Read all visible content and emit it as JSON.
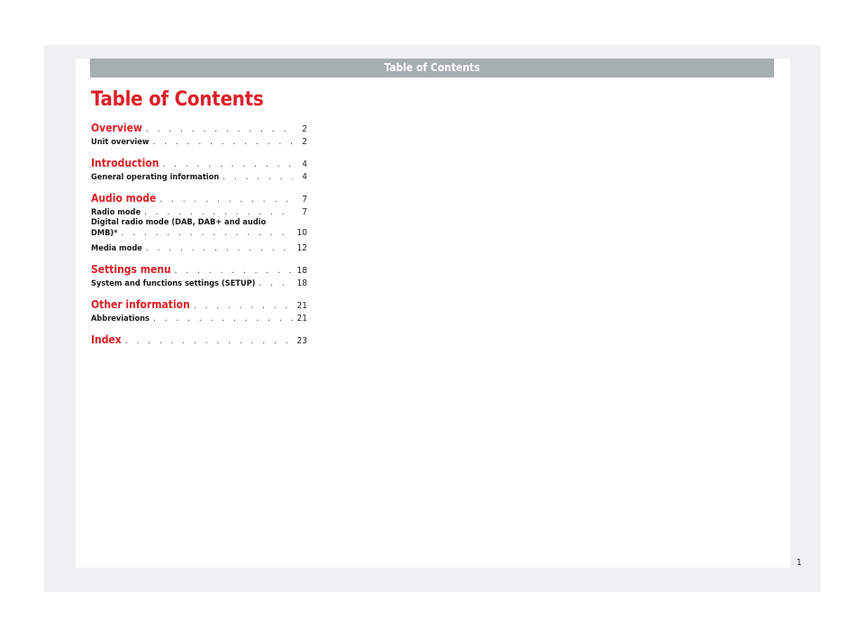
{
  "header": {
    "title": "Table of Contents"
  },
  "page_title": "Table of Contents",
  "dots": ". . . . . . . . . . . . . . . . . . . . . . . . . . . . . . . . . . . . . . . . . . . . . .",
  "toc": {
    "overview": {
      "label": "Overview",
      "page": "2"
    },
    "unit_overview": {
      "label": "Unit overview",
      "page": "2"
    },
    "introduction": {
      "label": "Introduction",
      "page": "4"
    },
    "general_operating": {
      "label": "General operating information",
      "page": "4"
    },
    "audio_mode": {
      "label": "Audio mode",
      "page": "7"
    },
    "radio_mode": {
      "label": "Radio mode",
      "page": "7"
    },
    "digital_radio": {
      "label_line1": "Digital radio mode (DAB, DAB+ and audio",
      "label_line2": "DMB)*",
      "page": "10"
    },
    "media_mode": {
      "label": "Media mode",
      "page": "12"
    },
    "settings_menu": {
      "label": "Settings menu",
      "page": "18"
    },
    "system_settings": {
      "label": "System and functions settings (SETUP)",
      "page": "18"
    },
    "other_information": {
      "label": "Other information",
      "page": "21"
    },
    "abbreviations": {
      "label": "Abbreviations",
      "page": "21"
    },
    "index": {
      "label": "Index",
      "page": "23"
    }
  },
  "footer": {
    "page_number": "1"
  },
  "colors": {
    "accent": "#dd1f26",
    "header_bar": "#a7aeb0",
    "background": "#eef0f1"
  }
}
